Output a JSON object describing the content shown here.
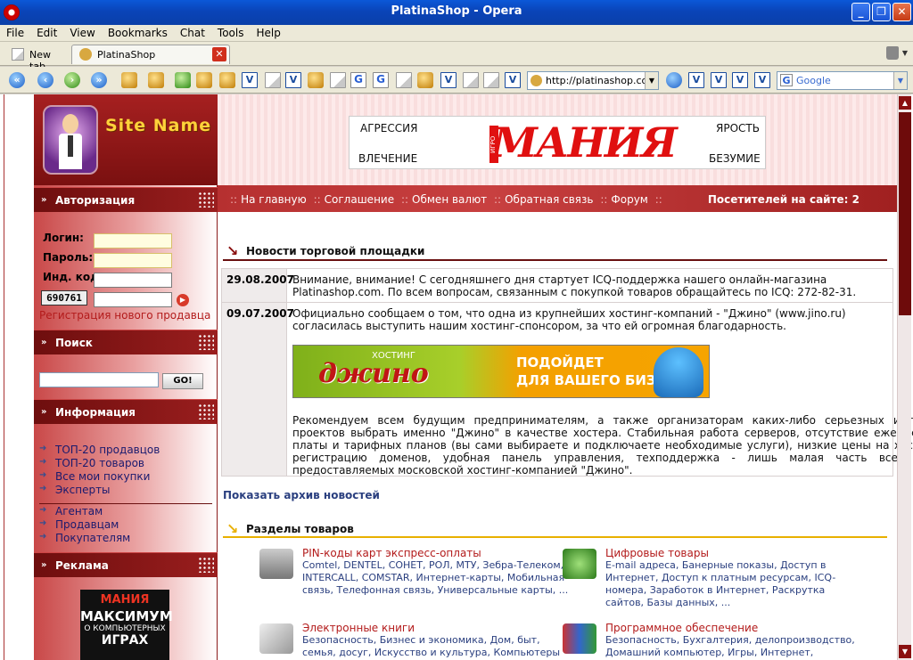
{
  "window": {
    "title": "PlatinaShop - Opera",
    "minimize": "_",
    "maximize": "❐",
    "close": "✕"
  },
  "menu": [
    "File",
    "Edit",
    "View",
    "Bookmarks",
    "Chat",
    "Tools",
    "Help"
  ],
  "tabs": {
    "new_tab": "New tab",
    "active": "PlatinaShop",
    "close": "✕"
  },
  "toolbar": {
    "address": "http://platinashop.com",
    "search_placeholder": "Google",
    "dropdown": "▼"
  },
  "site": {
    "name": "Site Name",
    "banner": {
      "left_top": "АГРЕССИЯ",
      "left_bottom": "ВЛЕЧЕНИЕ",
      "right_top": "ЯРОСТЬ",
      "right_bottom": "БЕЗУМИЕ",
      "brand": "МАНИЯ",
      "brand_prefix": "ИГРО"
    },
    "nav": {
      "sep": "::",
      "items": [
        "На главную",
        "Соглашение",
        "Обмен валют",
        "Обратная связь",
        "Форум"
      ],
      "visitors": "Посетителей на сайте: 2"
    }
  },
  "sidebar": {
    "auth": {
      "title": "Авторизация",
      "login_label": "Логин:",
      "password_label": "Пароль:",
      "index_label": "Инд. код:",
      "captcha": "690761",
      "register": "Регистрация нового продавца"
    },
    "search": {
      "title": "Поиск",
      "go": "GO!"
    },
    "info": {
      "title": "Информация",
      "items_a": [
        "ТОП-20 продавцов",
        "ТОП-20 товаров",
        "Все мои покупки",
        "Эксперты"
      ],
      "items_b": [
        "Агентам",
        "Продавцам",
        "Покупателям"
      ]
    },
    "ads": {
      "title": "Реклама",
      "logo": "МАНИЯ",
      "line1": "МАКСИМУМ",
      "line2": "О КОМПЬЮТЕРНЫХ",
      "line3": "ИГРАХ"
    }
  },
  "news": {
    "heading": "Новости торговой площадки",
    "items": [
      {
        "date": "29.08.2007",
        "text": "Внимание, внимание! С сегодняшнего дня стартует ICQ-поддержка нашего онлайн-магазина Platinashop.com. По всем вопросам, связанным с покупкой товаров обращайтесь по ICQ: 272-82-31."
      },
      {
        "date": "09.07.2007",
        "text": "Официально сообщаем о том, что одна из крупнейших хостинг-компаний - \"Джино\" (www.jino.ru) согласилась выступить нашим хостинг-спонсором, за что ей огромная благодарность.",
        "text2": "Рекомендуем всем будущим предпринимателям, а также организаторам каких-либо серьезных интернет-проектов выбрать именно \"Джино\" в качестве хостера. Стабильная работа серверов, отсутствие ежемесячной платы и тарифных планов (вы сами выбираете и подключаете необходимые услуги), низкие цены на хостинг и регистрацию доменов, удобная панель управления, техподдержка - лишь малая часть всех услуг, предоставляемых московской хостинг-компанией \"Джино\"."
      }
    ],
    "jino": {
      "host": "ХОСТИНГ",
      "brand": "джино",
      "line1": "ПОДОЙДЕТ",
      "line2": "ДЛЯ ВАШЕГО БИЗНЕСА"
    },
    "archive": "Показать архив новостей"
  },
  "categories": {
    "heading": "Разделы товаров",
    "items": [
      {
        "title": "PIN-коды карт экспресс-оплаты",
        "list": "Comtel, DENTEL, СОНЕТ, РОЛ, МТУ, Зебра-Телеком, INTERCALL, COMSTAR, Интернет-карты, Мобильная связь, Телефонная связь, Универсальные карты, ..."
      },
      {
        "title": "Цифровые товары",
        "list": "E-mail адреса, Банерные показы, Доступ в Интернет, Доступ к платным ресурсам, ICQ-номера, Заработок в Интернет, Раскрутка сайтов, Базы данных, ..."
      },
      {
        "title": "Электронные книги",
        "list": "Безопасность, Бизнес и экономика, Дом, быт, семья, досуг, Искусство и культура, Компьютеры"
      },
      {
        "title": "Программное обеспечение",
        "list": "Безопасность, Бухгалтерия, делопроизводство, Домашний компьютер, Игры, Интернет,"
      }
    ]
  },
  "colors": {
    "brand_red": "#8a1010",
    "link_blue": "#2a3f7f",
    "accent_gold": "#e8b000"
  }
}
